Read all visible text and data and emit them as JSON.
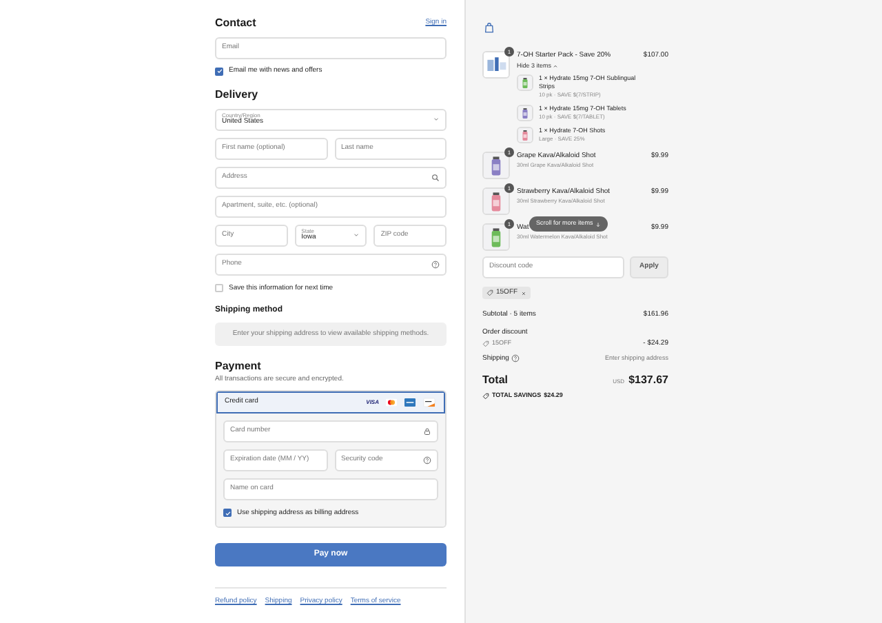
{
  "contact": {
    "title": "Contact",
    "sign_in": "Sign in",
    "email": {
      "placeholder": "Email"
    },
    "news": {
      "label": "Email me with news and offers",
      "checked": true
    }
  },
  "delivery": {
    "title": "Delivery",
    "country": {
      "label": "Country/Region",
      "value": "United States"
    },
    "first_name": {
      "placeholder": "First name (optional)"
    },
    "last_name": {
      "placeholder": "Last name"
    },
    "address": {
      "placeholder": "Address"
    },
    "apartment": {
      "placeholder": "Apartment, suite, etc. (optional)"
    },
    "city": {
      "placeholder": "City"
    },
    "state": {
      "label": "State",
      "value": "Iowa"
    },
    "zip": {
      "placeholder": "ZIP code"
    },
    "phone": {
      "placeholder": "Phone"
    },
    "save_info": {
      "label": "Save this information for next time",
      "checked": false
    }
  },
  "shipping_method": {
    "title": "Shipping method",
    "message": "Enter your shipping address to view available shipping methods."
  },
  "payment": {
    "title": "Payment",
    "subtitle": "All transactions are secure and encrypted.",
    "method": {
      "label": "Credit card",
      "selected": true,
      "visa": "VISA"
    },
    "card_number": {
      "placeholder": "Card number"
    },
    "expiration": {
      "placeholder": "Expiration date (MM / YY)"
    },
    "security_code": {
      "placeholder": "Security code"
    },
    "name_on_card": {
      "placeholder": "Name on card"
    },
    "billing": {
      "label": "Use shipping address as billing address",
      "checked": true
    }
  },
  "pay_button": "Pay now",
  "footer_links": [
    "Refund policy",
    "Shipping",
    "Privacy policy",
    "Terms of service"
  ],
  "cart": {
    "items": [
      {
        "quantity": "1",
        "name": "7-OH Starter Pack - Save 20%",
        "price": "$107.00",
        "toggle": "Hide 3 items",
        "sub_items": [
          {
            "name": "1 × Hydrate 15mg 7-OH Sublingual Strips",
            "detail": "10 pk · SAVE $(7/STRIP)"
          },
          {
            "name": "1 × Hydrate 15mg 7-OH Tablets",
            "detail": "10 pk · SAVE $(7/TABLET)"
          },
          {
            "name": "1 × Hydrate 7-OH Shots",
            "detail": "Large · SAVE 25%"
          }
        ]
      },
      {
        "quantity": "1",
        "name": "Grape Kava/Alkaloid Shot",
        "detail": "30ml Grape Kava/Alkaloid Shot",
        "price": "$9.99"
      },
      {
        "quantity": "1",
        "name": "Strawberry Kava/Alkaloid Shot",
        "detail": "30ml Strawberry Kava/Alkaloid Shot",
        "price": "$9.99"
      },
      {
        "quantity": "1",
        "name": "Wat",
        "detail": "30ml Watermelon Kava/Alkaloid Shot",
        "price": "$9.99"
      }
    ],
    "scroll_hint": "Scroll for more items",
    "discount": {
      "placeholder": "Discount code",
      "button": "Apply"
    },
    "applied_code": "15OFF",
    "subtotal": {
      "label": "Subtotal · 5 items",
      "value": "$161.96"
    },
    "order_discount": {
      "label": "Order discount",
      "code": "15OFF",
      "value": "- $24.29"
    },
    "shipping": {
      "label": "Shipping",
      "value": "Enter shipping address"
    },
    "total": {
      "label": "Total",
      "currency": "USD",
      "value": "$137.67"
    },
    "savings": {
      "label": "TOTAL SAVINGS",
      "value": "$24.29"
    }
  }
}
